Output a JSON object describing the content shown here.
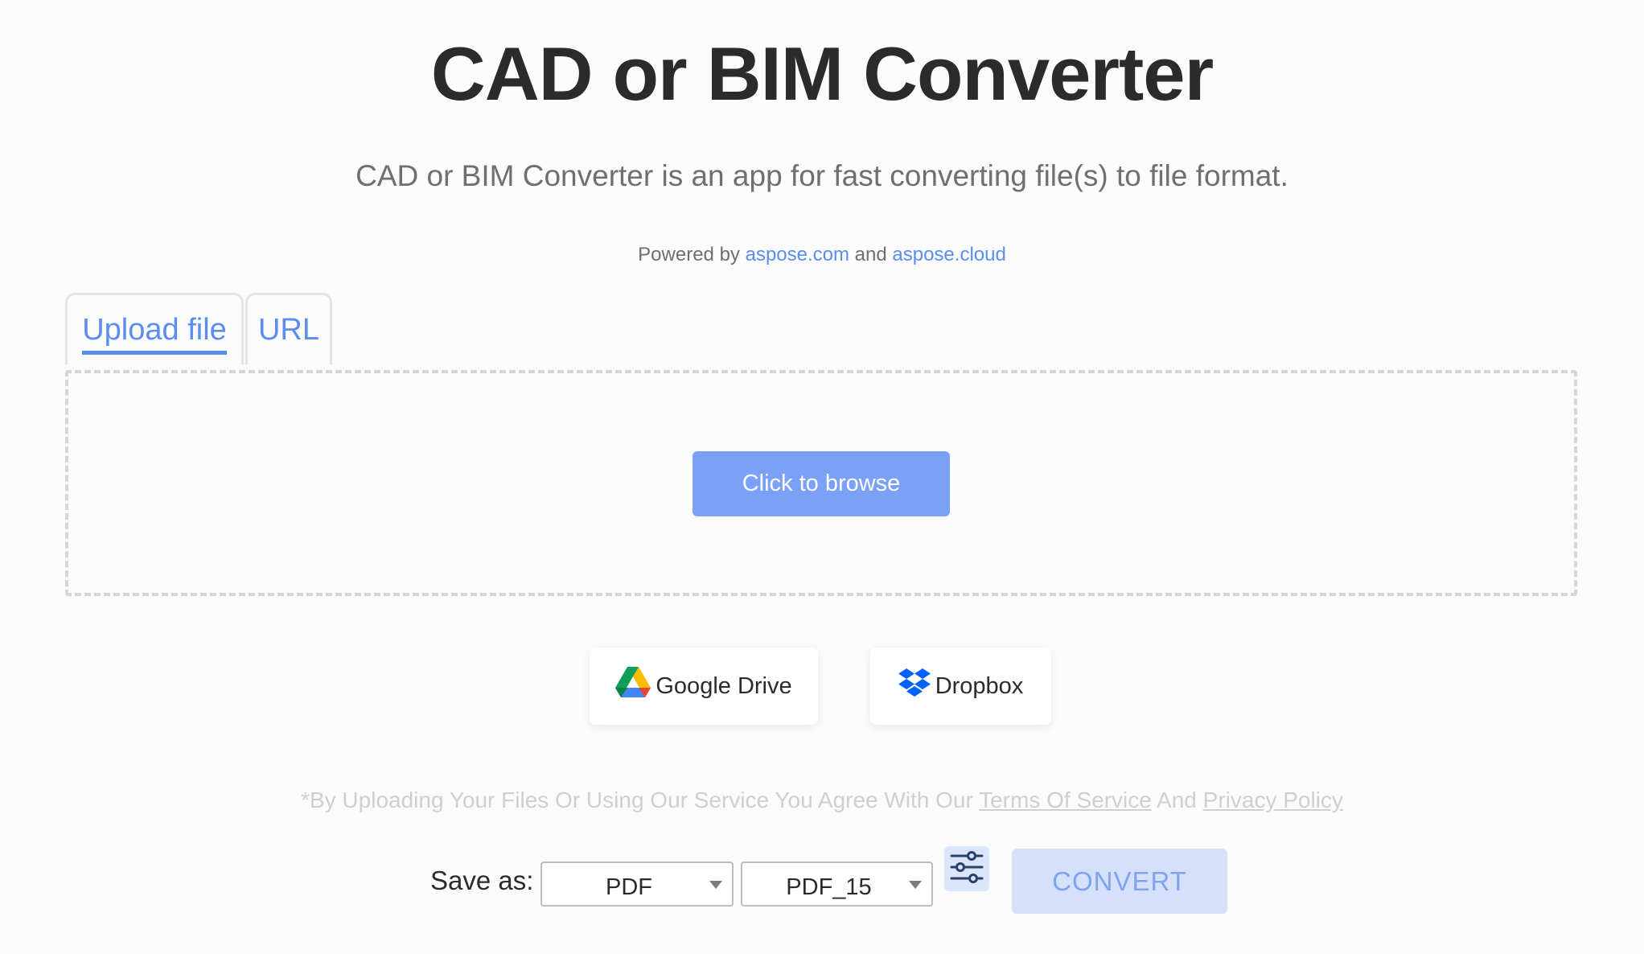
{
  "header": {
    "title": "CAD or BIM Converter",
    "subtitle": "CAD or BIM Converter is an app for fast converting file(s) to file format."
  },
  "powered": {
    "prefix": "Powered by",
    "link1": "aspose.com",
    "and": "and",
    "link2": "aspose.cloud"
  },
  "tabs": {
    "upload": "Upload file",
    "url": "URL"
  },
  "upload": {
    "browse_label": "Click to browse"
  },
  "cloud": {
    "gdrive_label": "Google Drive",
    "dropbox_label": "Dropbox"
  },
  "legal": {
    "prefix": "*By Uploading Your Files Or Using Our Service You Agree With Our",
    "terms": "Terms Of Service",
    "and": "And",
    "privacy": "Privacy Policy"
  },
  "save": {
    "label": "Save as:",
    "format": "PDF",
    "version": "PDF_15",
    "convert_label": "CONVERT"
  },
  "colors": {
    "accent": "#5b8def",
    "browse_button": "#7ba1f6",
    "convert_disabled": "#d5e1fb"
  }
}
